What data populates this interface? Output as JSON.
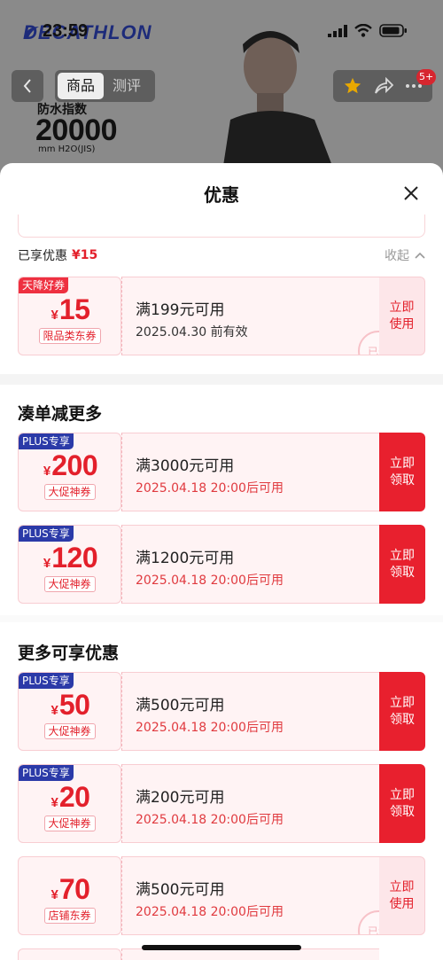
{
  "status": {
    "time": "23:59",
    "brand": "DECATHLON"
  },
  "nav": {
    "tab_product": "商品",
    "tab_review": "测评",
    "cart_badge": "5+"
  },
  "product_banner": {
    "label": "防水指数",
    "value": "20000",
    "unit": "mm H2O(JIS)"
  },
  "sheet": {
    "title": "优惠",
    "enjoyed_label": "已享优惠",
    "enjoyed_amount": "¥15",
    "collapse_label": "收起"
  },
  "applied_coupon": {
    "tag": "天降好券",
    "yen": "¥",
    "amount": "15",
    "type": "限品类东券",
    "condition": "满199元可用",
    "date": "2025.04.30 前有效",
    "action": "立即使用",
    "stamp": "已选"
  },
  "section_more_discount": {
    "title": "凑单减更多",
    "coupons": [
      {
        "tag": "PLUS专享",
        "yen": "¥",
        "amount": "200",
        "type": "大促神券",
        "condition": "满3000元可用",
        "date": "2025.04.18 20:00后可用",
        "action": "立即领取"
      },
      {
        "tag": "PLUS专享",
        "yen": "¥",
        "amount": "120",
        "type": "大促神券",
        "condition": "满1200元可用",
        "date": "2025.04.18 20:00后可用",
        "action": "立即领取"
      }
    ]
  },
  "section_more_offers": {
    "title": "更多可享优惠",
    "coupons": [
      {
        "tag": "PLUS专享",
        "yen": "¥",
        "amount": "50",
        "type": "大促神券",
        "condition": "满500元可用",
        "date": "2025.04.18 20:00后可用",
        "action": "立即领取"
      },
      {
        "tag": "PLUS专享",
        "yen": "¥",
        "amount": "20",
        "type": "大促神券",
        "condition": "满200元可用",
        "date": "2025.04.18 20:00后可用",
        "action": "立即领取"
      },
      {
        "tag": "",
        "yen": "¥",
        "amount": "70",
        "type": "店铺东券",
        "condition": "满500元可用",
        "date": "2025.04.18 20:00后可用",
        "action": "立即使用",
        "stamp": "已领"
      }
    ]
  },
  "colors": {
    "accent_red": "#e8202e",
    "plus_blue": "#2b3aa8",
    "coupon_bg": "#fff3f4"
  }
}
